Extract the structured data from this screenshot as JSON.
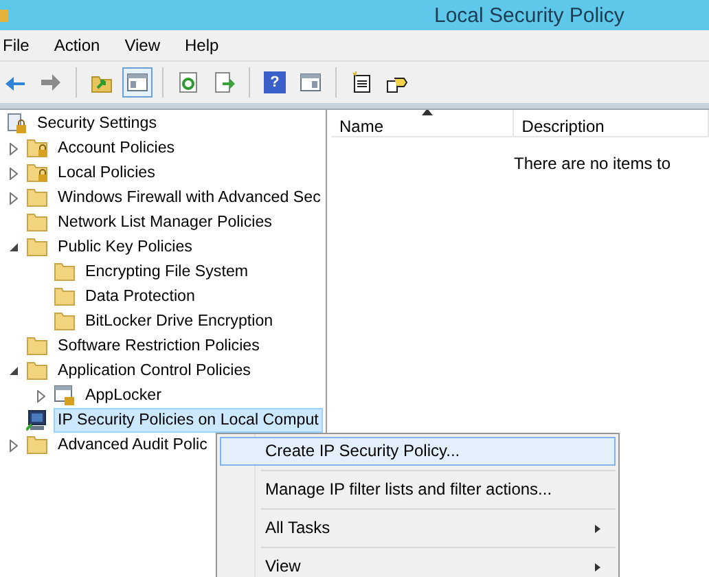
{
  "window": {
    "title": "Local Security Policy"
  },
  "menu_bar": [
    {
      "label": "File"
    },
    {
      "label": "Action"
    },
    {
      "label": "View"
    },
    {
      "label": "Help"
    }
  ],
  "toolbar": [
    {
      "kind": "back",
      "pressed": false
    },
    {
      "kind": "forward",
      "pressed": false
    },
    {
      "kind": "sep"
    },
    {
      "kind": "up",
      "pressed": false
    },
    {
      "kind": "tree",
      "pressed": true
    },
    {
      "kind": "sep"
    },
    {
      "kind": "refresh",
      "pressed": false
    },
    {
      "kind": "export",
      "pressed": false
    },
    {
      "kind": "sep"
    },
    {
      "kind": "help",
      "label": "?",
      "pressed": false
    },
    {
      "kind": "panel",
      "pressed": false
    },
    {
      "kind": "sep"
    },
    {
      "kind": "newdoc",
      "pressed": false
    },
    {
      "kind": "newpolicy",
      "pressed": false
    }
  ],
  "tree": [
    {
      "label": "Security Settings",
      "kind": "root",
      "selected": false,
      "children": [
        {
          "label": "Account Policies",
          "kind": "locked-folder",
          "expanded": false,
          "selected": false
        },
        {
          "label": "Local Policies",
          "kind": "locked-folder",
          "expanded": false,
          "selected": false
        },
        {
          "label": "Windows Firewall with Advanced Sec",
          "kind": "folder",
          "expanded": false,
          "selected": false
        },
        {
          "label": "Network List Manager Policies",
          "kind": "folder",
          "selected": false
        },
        {
          "label": "Public Key Policies",
          "kind": "folder",
          "expanded": true,
          "selected": false,
          "children": [
            {
              "label": "Encrypting File System",
              "kind": "folder",
              "selected": false
            },
            {
              "label": "Data Protection",
              "kind": "folder",
              "selected": false
            },
            {
              "label": "BitLocker Drive Encryption",
              "kind": "folder",
              "selected": false
            }
          ]
        },
        {
          "label": "Software Restriction Policies",
          "kind": "folder",
          "selected": false
        },
        {
          "label": "Application Control Policies",
          "kind": "folder",
          "expanded": true,
          "selected": false,
          "children": [
            {
              "label": "AppLocker",
              "kind": "applocker",
              "expanded": false,
              "selected": false
            }
          ]
        },
        {
          "label": "IP Security Policies on Local Comput",
          "kind": "computer",
          "selected": true
        },
        {
          "label": "Advanced Audit Polic",
          "kind": "folder",
          "expanded": false,
          "selected": false
        }
      ]
    }
  ],
  "list": {
    "columns": [
      {
        "label": "Name",
        "sorted": true
      },
      {
        "label": "Description",
        "sorted": false
      }
    ],
    "empty_message": "There are no items to"
  },
  "context_menu": [
    {
      "label": "Create IP Security Policy...",
      "selected": true,
      "has_submenu": false
    },
    {
      "label": "Manage IP filter lists and filter actions...",
      "selected": false,
      "has_submenu": false
    },
    {
      "label": "All Tasks",
      "selected": false,
      "has_submenu": true
    },
    {
      "label": "View",
      "selected": false,
      "has_submenu": true
    }
  ]
}
